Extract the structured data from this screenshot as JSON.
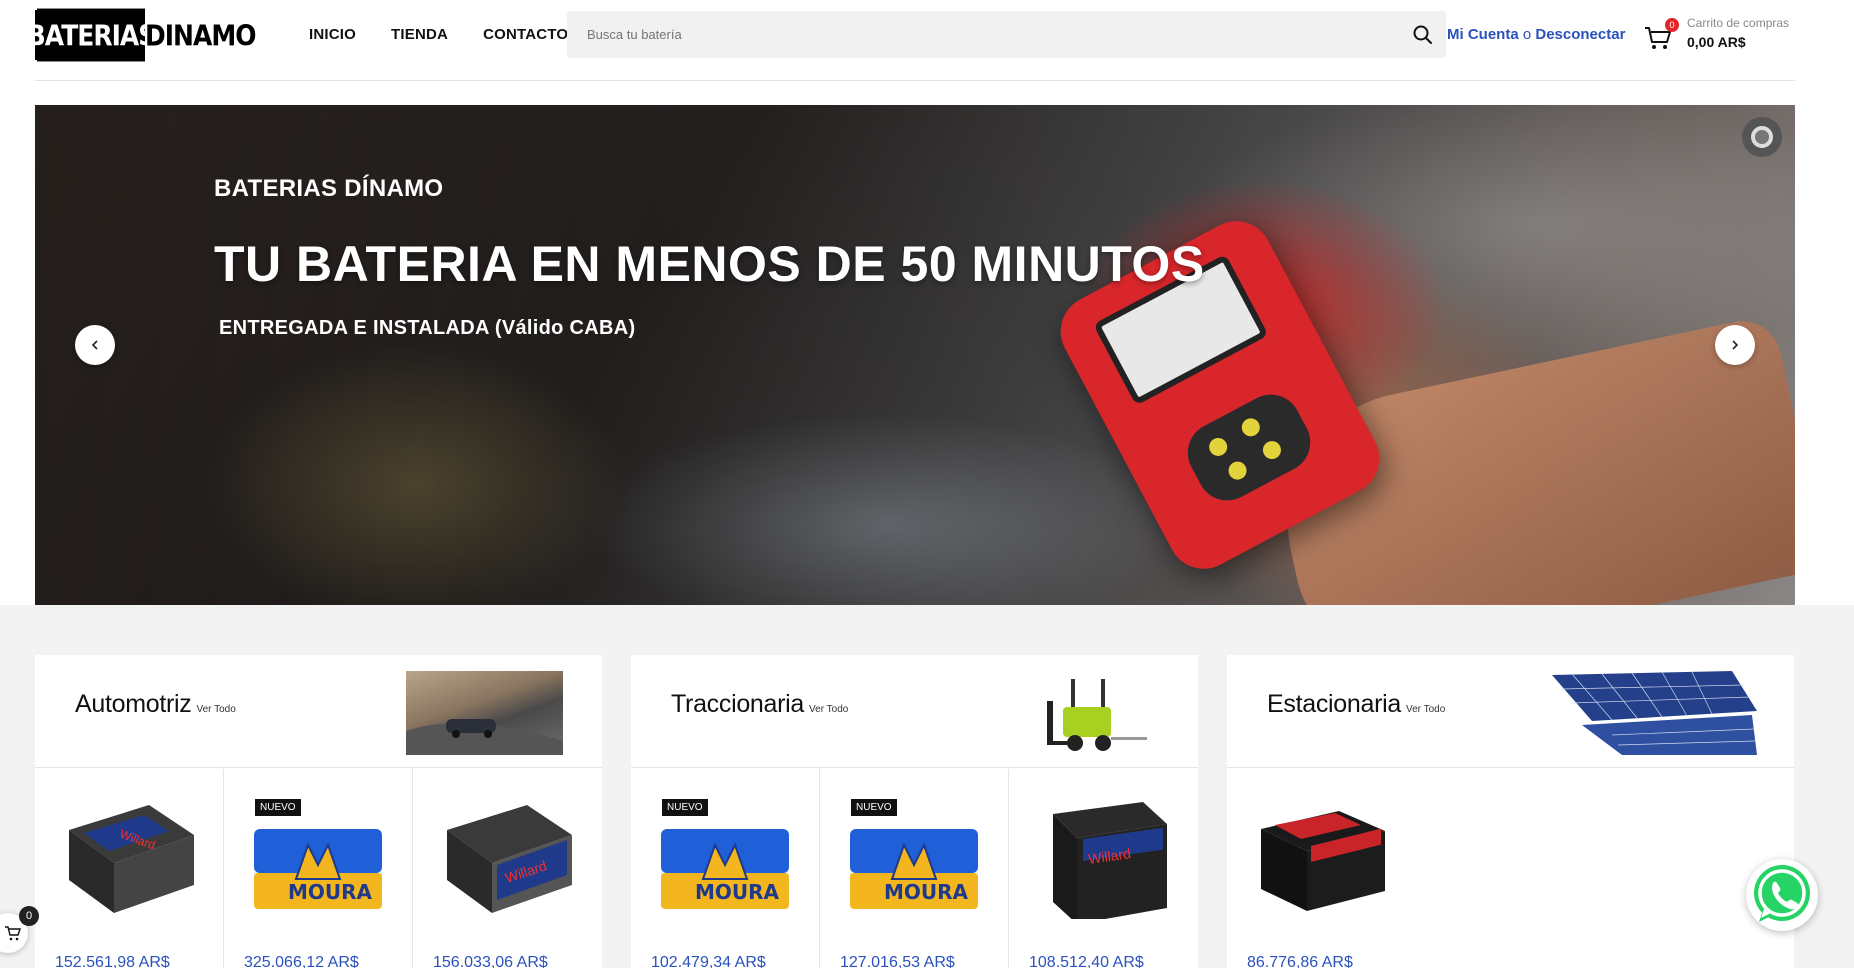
{
  "brand": {
    "left": "BATERIAS",
    "right": "DINAMO"
  },
  "nav": {
    "items": [
      "INICIO",
      "TIENDA",
      "CONTACTO"
    ]
  },
  "search": {
    "placeholder": "Busca tu batería"
  },
  "account": {
    "my_account": "Mi Cuenta",
    "separator": "o",
    "logout": "Desconectar"
  },
  "cart": {
    "count": "0",
    "label": "Carrito de compras",
    "total": "0,00 AR$"
  },
  "hero": {
    "subtitle": "BATERIAS DÍNAMO",
    "title": "TU BATERIA EN MENOS DE 50 MINUTOS",
    "note": "ENTREGADA E INSTALADA (Válido CABA)"
  },
  "categories": [
    {
      "title": "Automotriz",
      "view_all": "Ver Todo",
      "products": [
        {
          "badge": "",
          "price": "152.561,98 AR$",
          "brand": "Willard"
        },
        {
          "badge": "NUEVO",
          "price": "325.066,12 AR$",
          "brand": "Moura"
        },
        {
          "badge": "",
          "price": "156.033,06 AR$",
          "brand": "Willard"
        }
      ]
    },
    {
      "title": "Traccionaria",
      "view_all": "Ver Todo",
      "products": [
        {
          "badge": "NUEVO",
          "price": "102.479,34 AR$",
          "brand": "Moura"
        },
        {
          "badge": "NUEVO",
          "price": "127.016,53 AR$",
          "brand": "Moura"
        },
        {
          "badge": "",
          "price": "108.512,40 AR$",
          "brand": "Willard"
        }
      ]
    },
    {
      "title": "Estacionaria",
      "view_all": "Ver Todo",
      "products": [
        {
          "badge": "",
          "price": "86.776,86 AR$",
          "brand": "Willard"
        }
      ]
    }
  ],
  "floating_cart": {
    "count": "0"
  },
  "colors": {
    "link_blue": "#2a52be",
    "badge_red": "#e5252a",
    "whatsapp": "#25d366",
    "moura_blue": "#1f5fd8",
    "moura_yellow": "#f3b61f"
  },
  "icons": [
    "search-icon",
    "cart-icon",
    "chevron-left-icon",
    "chevron-right-icon",
    "pause-icon",
    "whatsapp-icon"
  ]
}
